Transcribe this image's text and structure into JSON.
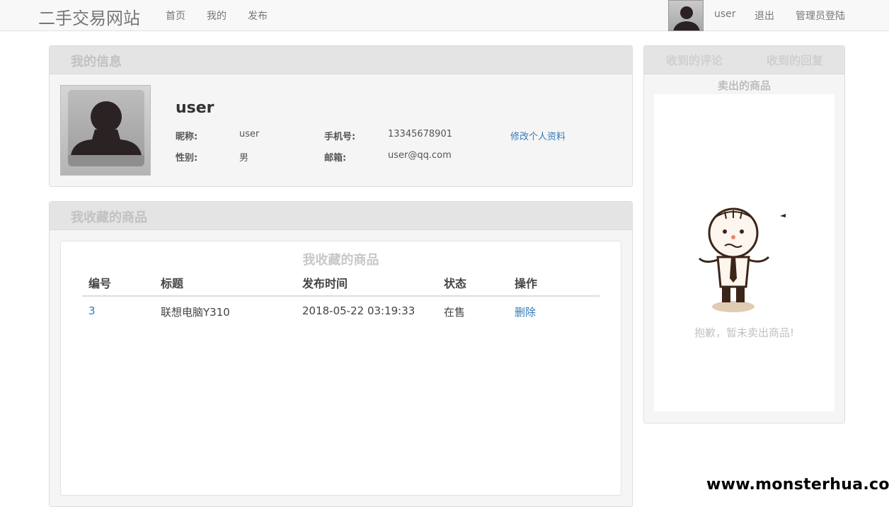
{
  "navbar": {
    "brand": "二手交易网站",
    "links": [
      "首页",
      "我的",
      "发布"
    ],
    "username": "user",
    "logout": "退出",
    "admin_login": "管理员登陆"
  },
  "profile": {
    "panel_title": "我的信息",
    "name": "user",
    "fields": {
      "nickname_label": "昵称:",
      "nickname": "user",
      "phone_label": "手机号:",
      "phone": "13345678901",
      "gender_label": "性别:",
      "gender": "男",
      "email_label": "邮箱:",
      "email": "user@qq.com"
    },
    "edit_link": "修改个人资料"
  },
  "favorites": {
    "panel_title": "我收藏的商品",
    "caption": "我收藏的商品",
    "columns": [
      "编号",
      "标题",
      "发布时间",
      "状态",
      "操作"
    ],
    "rows": [
      {
        "id": "3",
        "title": "联想电脑Y310",
        "time": "2018-05-22 03:19:33",
        "status": "在售",
        "action": "删除"
      }
    ]
  },
  "right_panel": {
    "tabs": [
      "收到的评论",
      "收到的回复"
    ],
    "subtitle": "卖出的商品",
    "empty_message": "抱歉，暂未卖出商品!"
  },
  "watermark": "www.monsterhua.com",
  "colors": {
    "link": "#337ab7",
    "panel_head": "#e4e4e4",
    "muted_title": "#c2c2c2"
  }
}
